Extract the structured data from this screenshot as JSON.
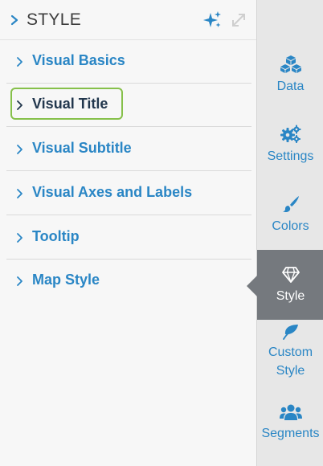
{
  "panel": {
    "title": "STYLE",
    "sections": [
      {
        "label": "Visual Basics"
      },
      {
        "label": "Visual Title"
      },
      {
        "label": "Visual Subtitle"
      },
      {
        "label": "Visual Axes and Labels"
      },
      {
        "label": "Tooltip"
      },
      {
        "label": "Map Style"
      }
    ],
    "selected_section": "Visual Title",
    "icons": {
      "collapse": "chevron-right-icon",
      "magic": "sparkle-icon",
      "expand": "expand-icon"
    }
  },
  "nav": {
    "items": [
      {
        "label": "Data",
        "icon": "cubes-icon"
      },
      {
        "label": "Settings",
        "icon": "cogs-icon"
      },
      {
        "label": "Colors",
        "icon": "paint-brush-icon"
      },
      {
        "label": "Style",
        "icon": "diamond-icon"
      },
      {
        "label_line1": "Custom",
        "label_line2": "Style",
        "icon": "leaf-icon"
      },
      {
        "label": "Segments",
        "icon": "users-icon"
      }
    ],
    "active": "Style"
  },
  "colors": {
    "accent": "#2a86c5",
    "active_text": "#22374d",
    "highlight": "#86c04a",
    "active_nav_bg": "#75797e",
    "nav_bg": "#e7e7e7",
    "panel_bg": "#f7f7f7"
  }
}
